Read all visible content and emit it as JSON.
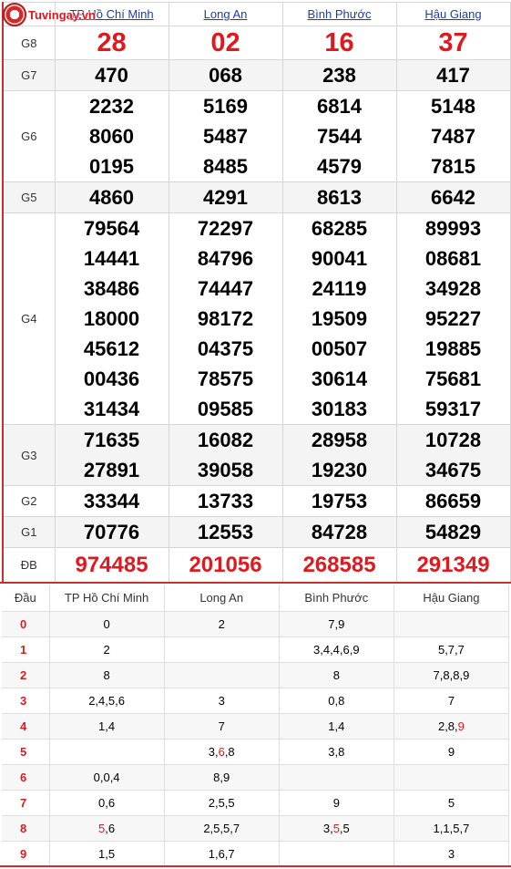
{
  "logo": {
    "text": "Tuvingay.vn",
    "seal_text": "XSKT"
  },
  "provinces": [
    "TP Hồ Chí Minh",
    "Long An",
    "Bình Phước",
    "Hậu Giang"
  ],
  "prizes": [
    {
      "label": "G8",
      "values": [
        [
          "28"
        ],
        [
          "02"
        ],
        [
          "16"
        ],
        [
          "37"
        ]
      ]
    },
    {
      "label": "G7",
      "values": [
        [
          "470"
        ],
        [
          "068"
        ],
        [
          "238"
        ],
        [
          "417"
        ]
      ]
    },
    {
      "label": "G6",
      "values": [
        [
          "2232",
          "8060",
          "0195"
        ],
        [
          "5169",
          "5487",
          "8485"
        ],
        [
          "6814",
          "7544",
          "4579"
        ],
        [
          "5148",
          "7487",
          "7815"
        ]
      ]
    },
    {
      "label": "G5",
      "values": [
        [
          "4860"
        ],
        [
          "4291"
        ],
        [
          "8613"
        ],
        [
          "6642"
        ]
      ]
    },
    {
      "label": "G4",
      "values": [
        [
          "79564",
          "14441",
          "38486",
          "18000",
          "45612",
          "00436",
          "31434"
        ],
        [
          "72297",
          "84796",
          "74447",
          "98172",
          "04375",
          "78575",
          "09585"
        ],
        [
          "68285",
          "90041",
          "24119",
          "19509",
          "00507",
          "30614",
          "30183"
        ],
        [
          "89993",
          "08681",
          "34928",
          "95227",
          "19885",
          "75681",
          "59317"
        ]
      ]
    },
    {
      "label": "G3",
      "values": [
        [
          "71635",
          "27891"
        ],
        [
          "16082",
          "39058"
        ],
        [
          "28958",
          "19230"
        ],
        [
          "10728",
          "34675"
        ]
      ]
    },
    {
      "label": "G2",
      "values": [
        [
          "33344"
        ],
        [
          "13733"
        ],
        [
          "19753"
        ],
        [
          "86659"
        ]
      ]
    },
    {
      "label": "G1",
      "values": [
        [
          "70776"
        ],
        [
          "12553"
        ],
        [
          "84728"
        ],
        [
          "54829"
        ]
      ]
    },
    {
      "label": "ĐB",
      "values": [
        [
          "974485"
        ],
        [
          "201056"
        ],
        [
          "268585"
        ],
        [
          "291349"
        ]
      ]
    }
  ],
  "loto": {
    "header_label": "Đầu",
    "rows": [
      {
        "head": "0",
        "cells": [
          "0",
          "2",
          "7,9",
          ""
        ]
      },
      {
        "head": "1",
        "cells": [
          "2",
          "",
          "3,4,4,6,9",
          "5,7,7"
        ]
      },
      {
        "head": "2",
        "cells": [
          "8",
          "",
          "8",
          "7,8,8,9"
        ]
      },
      {
        "head": "3",
        "cells": [
          "2,4,5,6",
          "3",
          "0,8",
          "7"
        ]
      },
      {
        "head": "4",
        "cells": [
          "1,4",
          "7",
          "1,4",
          "2,8,9"
        ]
      },
      {
        "head": "5",
        "cells": [
          "",
          "3,6,8",
          "3,8",
          "9"
        ]
      },
      {
        "head": "6",
        "cells": [
          "0,0,4",
          "8,9",
          "",
          ""
        ]
      },
      {
        "head": "7",
        "cells": [
          "0,6",
          "2,5,5",
          "9",
          "5"
        ]
      },
      {
        "head": "8",
        "cells": [
          "5,6",
          "2,5,5,7",
          "3,5,5",
          "1,1,5,7"
        ]
      },
      {
        "head": "9",
        "cells": [
          "1,5",
          "1,6,7",
          "",
          "3"
        ]
      }
    ]
  },
  "colors": {
    "accent": "#e0191f",
    "link": "#1a3cb8",
    "border": "#c9302c"
  }
}
